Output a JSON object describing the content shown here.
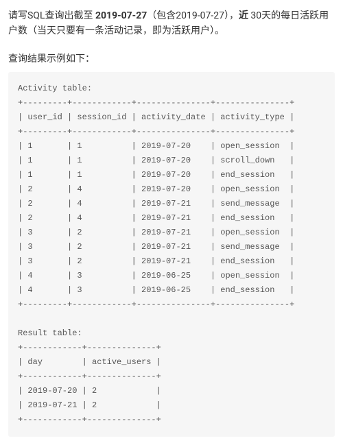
{
  "description": {
    "prefix": "请写SQL查询出截至 ",
    "date_bold": "2019-07-27",
    "after_date": "（包含2019-07-27），",
    "near_bold": "近",
    "suffix": " 30天的每日活跃用户数（当天只要有一条活动记录，即为活跃用户）。"
  },
  "example_label": "查询结果示例如下：",
  "code": {
    "activity_header": "Activity table:",
    "activity_sep": "+---------+------------+---------------+---------------+",
    "activity_cols": "| user_id | session_id | activity_date | activity_type |",
    "activity_rows": [
      "| 1       | 1          | 2019-07-20    | open_session  |",
      "| 1       | 1          | 2019-07-20    | scroll_down   |",
      "| 1       | 1          | 2019-07-20    | end_session   |",
      "| 2       | 4          | 2019-07-20    | open_session  |",
      "| 2       | 4          | 2019-07-21    | send_message  |",
      "| 2       | 4          | 2019-07-21    | end_session   |",
      "| 3       | 2          | 2019-07-21    | open_session  |",
      "| 3       | 2          | 2019-07-21    | send_message  |",
      "| 3       | 2          | 2019-07-21    | end_session   |",
      "| 4       | 3          | 2019-06-25    | open_session  |",
      "| 4       | 3          | 2019-06-25    | end_session   |"
    ],
    "result_header": "Result table:",
    "result_sep": "+------------+--------------+",
    "result_cols": "| day        | active_users |",
    "result_rows": [
      "| 2019-07-20 | 2            |",
      "| 2019-07-21 | 2            |"
    ]
  }
}
